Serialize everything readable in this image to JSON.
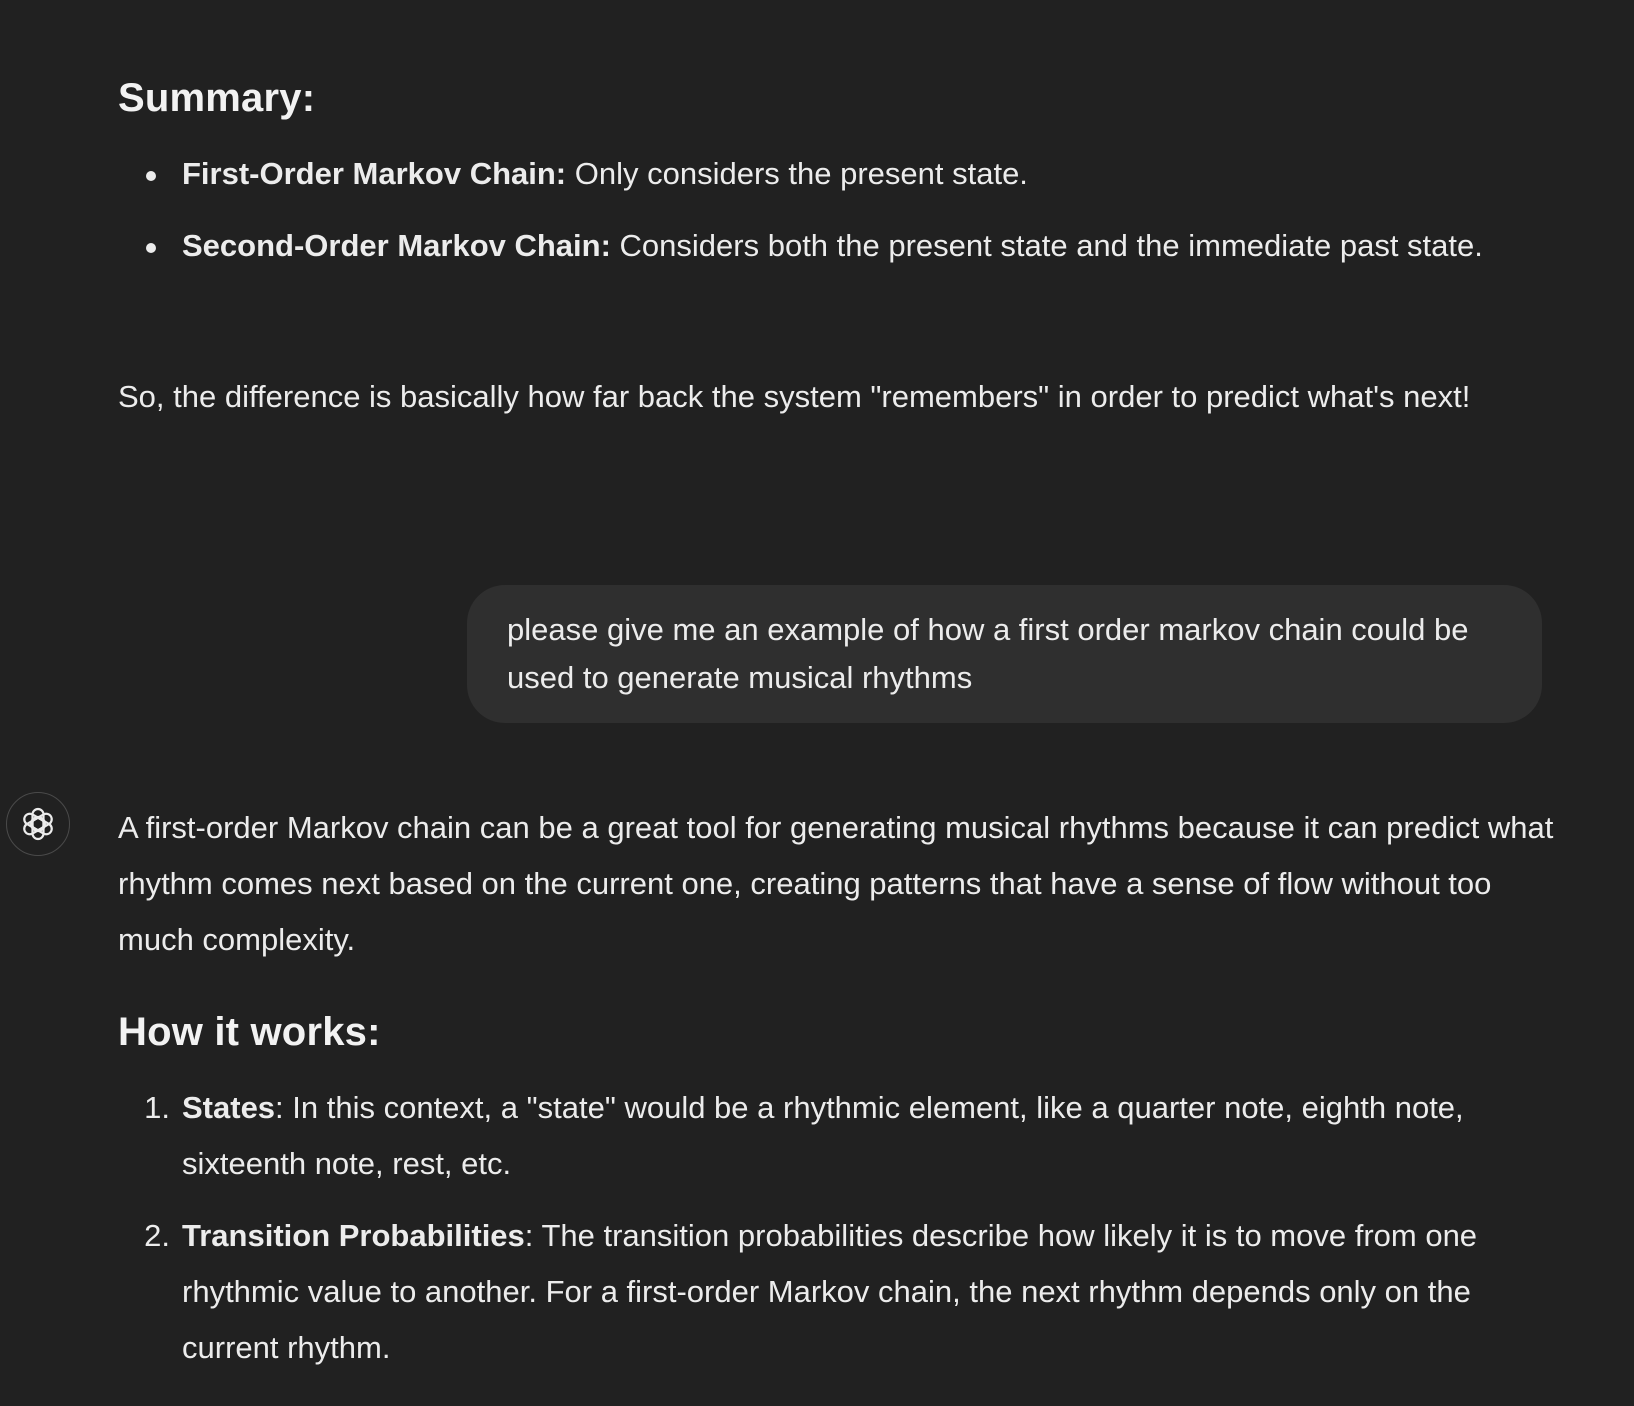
{
  "previous_response": {
    "summary_heading": "Summary:",
    "bullets": [
      {
        "term": "First-Order Markov Chain:",
        "text": " Only considers the present state."
      },
      {
        "term": "Second-Order Markov Chain:",
        "text": " Considers both the present state and the immediate past state."
      }
    ],
    "closing": "So, the difference is basically how far back the system \"remembers\" in order to predict what's next!"
  },
  "user_message": {
    "text": "please give me an example of how a first order markov chain could be used to generate musical rhythms"
  },
  "assistant_response": {
    "avatar_icon": "openai-logo-icon",
    "intro": "A first-order Markov chain can be a great tool for generating musical rhythms because it can predict what rhythm comes next based on the current one, creating patterns that have a sense of flow without too much complexity.",
    "how_heading": "How it works:",
    "steps": [
      {
        "number": "1.",
        "term": "States",
        "text": ": In this context, a \"state\" would be a rhythmic element, like a quarter note, eighth note, sixteenth note, rest, etc."
      },
      {
        "number": "2.",
        "term": "Transition Probabilities",
        "text": ": The transition probabilities describe how likely it is to move from one rhythmic value to another. For a first-order Markov chain, the next rhythm depends only on the current rhythm."
      }
    ]
  }
}
